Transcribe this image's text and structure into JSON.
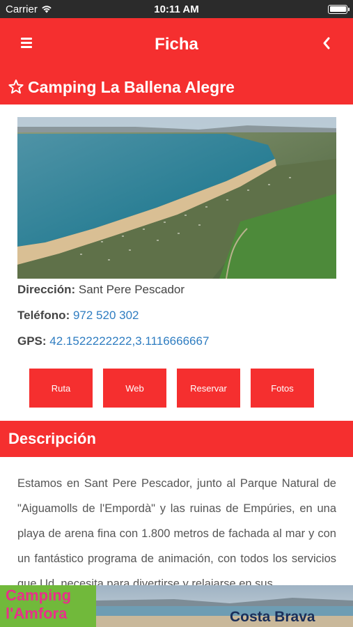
{
  "status_bar": {
    "carrier": "Carrier",
    "time": "10:11 AM"
  },
  "navbar": {
    "title": "Ficha"
  },
  "camping": {
    "name": "Camping La Ballena Alegre"
  },
  "details": {
    "address_label": "Dirección:",
    "address": "Sant Pere Pescador",
    "phone_label": "Teléfono:",
    "phone": "972 520 302",
    "gps_label": "GPS:",
    "gps": "42.1522222222,3.1116666667"
  },
  "buttons": {
    "route": "Ruta",
    "web": "Web",
    "reserve": "Reservar",
    "photos": "Fotos"
  },
  "description": {
    "heading": "Descripción",
    "text": "Estamos en Sant Pere Pescador, junto al Parque Natural de \"Aiguamolls de l'Empordà\" y las ruinas de Empúries, en una playa de arena fina con 1.800 metros de fachada al mar y con un fantástico programa de animación, con todos los servicios que Ud. necesita para divertirse y relajarse en sus"
  },
  "ad_banner": {
    "brand_line1": "Camping",
    "brand_line2": "l'Amfora",
    "region": "Costa Brava"
  },
  "colors": {
    "accent": "#f52f2f",
    "link": "#2f7dc1",
    "status_bar": "#2b2b2b"
  }
}
